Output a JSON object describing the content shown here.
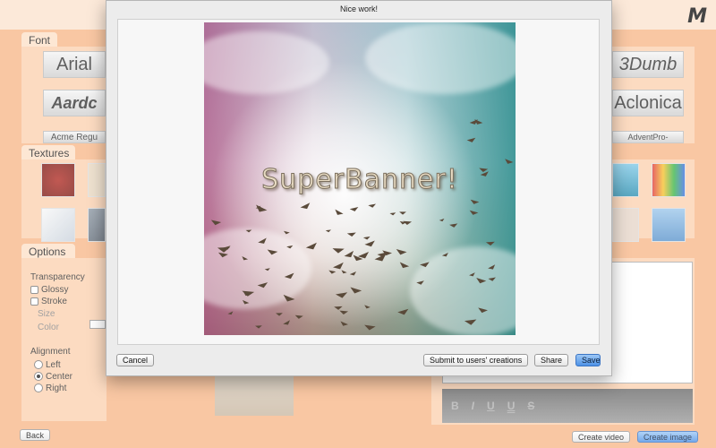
{
  "app": {
    "font_header": "Font",
    "textures_header": "Textures",
    "options_header": "Options",
    "font_tiles": [
      "Arial",
      "Aardc",
      "Acme Regu",
      "3Dumb",
      "Aclonica",
      "AdventPro-"
    ],
    "options": {
      "transparency": "Transparency",
      "glossy": "Glossy",
      "stroke": "Stroke",
      "size": "Size",
      "color": "Color",
      "alignment": "Alignment",
      "align_left": "Left",
      "align_center": "Center",
      "align_right": "Right"
    },
    "format_bar": [
      "B",
      "I",
      "U",
      "U",
      "S"
    ],
    "back_label": "Back",
    "create_video_label": "Create video",
    "create_image_label": "Create image"
  },
  "modal": {
    "title": "Nice work!",
    "banner_text": "SuperBanner!",
    "cancel_label": "Cancel",
    "submit_label": "Submit to users' creations",
    "share_label": "Share",
    "save_label": "Save"
  },
  "colors": {
    "accent_orange": "#f39a6a",
    "panel": "#fbd1b0",
    "save_blue": "#4d92e6"
  }
}
